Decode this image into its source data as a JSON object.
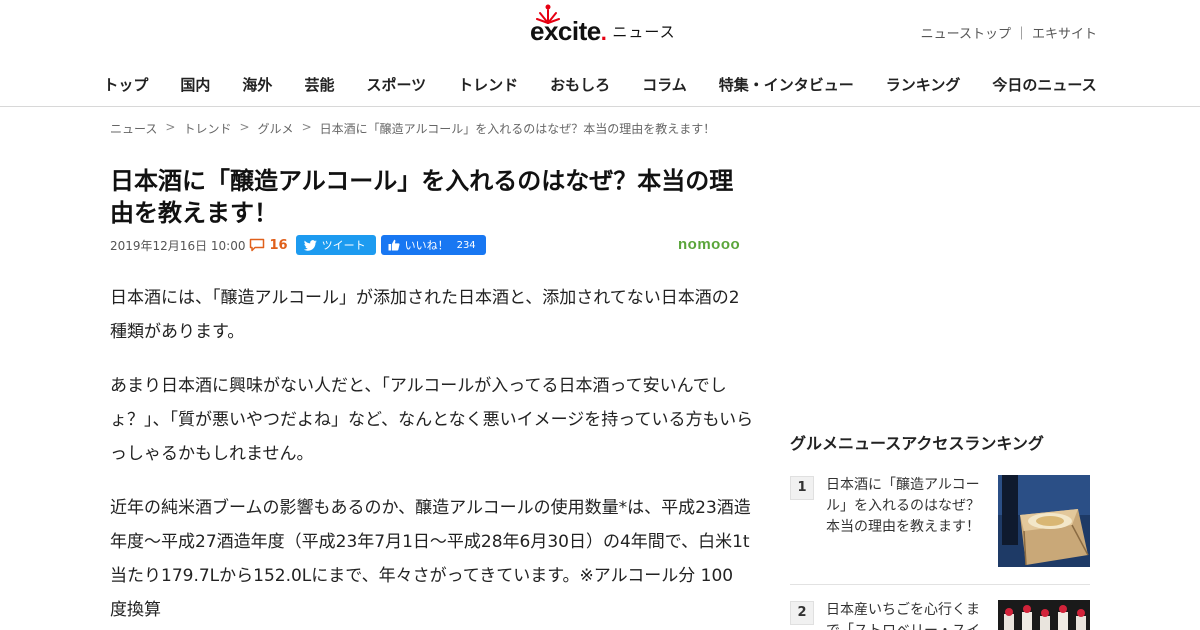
{
  "header": {
    "logo_text": "excite",
    "logo_suffix": "ニュース",
    "top_links": [
      "ニューストップ",
      "エキサイト"
    ],
    "top_link_separator": "｜"
  },
  "nav": {
    "items": [
      "トップ",
      "国内",
      "海外",
      "芸能",
      "スポーツ",
      "トレンド",
      "おもしろ",
      "コラム",
      "特集・インタビュー",
      "ランキング",
      "今日のニュース"
    ]
  },
  "breadcrumb": {
    "items": [
      "ニュース",
      "トレンド",
      "グルメ",
      "日本酒に「醸造アルコール」を入れるのはなぜ？本当の理由を教えます！"
    ],
    "separator": ">"
  },
  "article": {
    "title": "日本酒に「醸造アルコール」を入れるのはなぜ？本当の理由を教えます！",
    "date": "2019年12月16日 10:00",
    "comment_count": "16",
    "tweet_label": "ツイート",
    "like_label": "いいね！",
    "like_count": "234",
    "source": "nomooo",
    "paragraphs": [
      "日本酒には、「醸造アルコール」が添加された日本酒と、添加されてない日本酒の2種類があります。",
      "あまり日本酒に興味がない人だと、「アルコールが入ってる日本酒って安いんでしょ？」、「質が悪いやつだよね」など、なんとなく悪いイメージを持っている方もいらっしゃるかもしれません。",
      "近年の純米酒ブームの影響もあるのか、醸造アルコールの使用数量*は、平成23酒造年度～平成27酒造年度（平成23年7月1日～平成28年6月30日）の4年間で、白米1t当たり179.7Lから152.0Lにまで、年々さがってきています。※アルコール分 100 度換算"
    ]
  },
  "sidebar": {
    "ranking_title": "グルメニュースアクセスランキング",
    "items": [
      {
        "rank": "1",
        "title": "日本酒に「醸造アルコール」を入れるのはなぜ？本当の理由を教えます！"
      },
      {
        "rank": "2",
        "title": "日本産いちごを心行くまで「ストロベリー・スイ"
      }
    ]
  },
  "colors": {
    "accent_orange": "#e0601b",
    "twitter_blue": "#1d9bf0",
    "facebook_blue": "#1877f2",
    "source_green": "#5aa53a",
    "logo_red": "#e60012"
  }
}
